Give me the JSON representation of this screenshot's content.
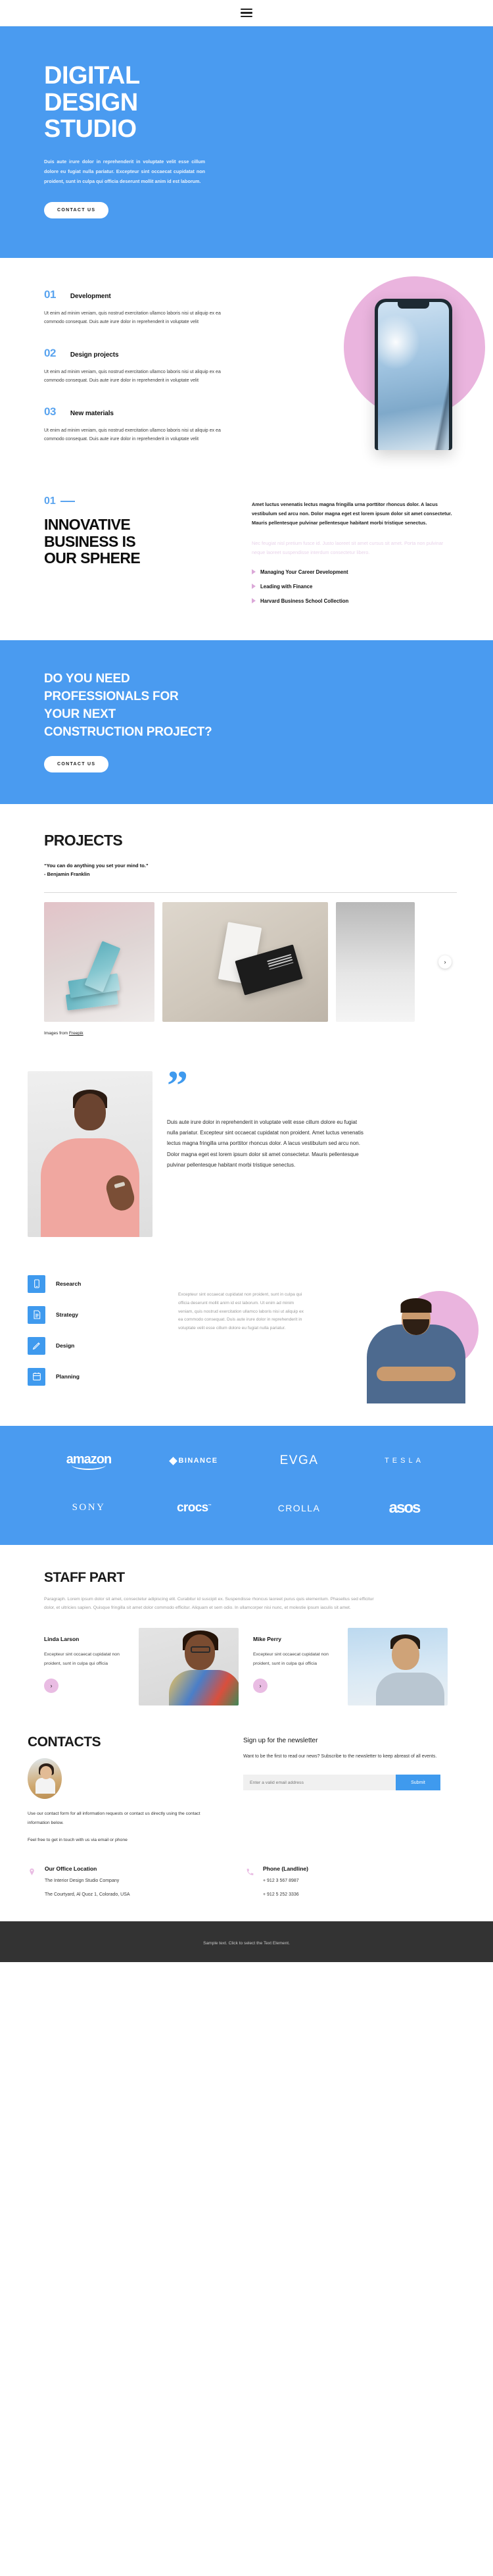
{
  "topbar": {
    "menu_icon": "hamburger-menu-icon"
  },
  "hero": {
    "title_line1": "DIGITAL",
    "title_line2": "DESIGN",
    "title_line3": "STUDIO",
    "paragraph": "Duis aute irure dolor in reprehenderit in voluptate velit esse cillum dolore eu fugiat nulla pariatur. Excepteur sint occaecat cupidatat non proident, sunt in culpa qui officia deserunt mollit anim id est laborum.",
    "cta_label": "CONTACT US",
    "bg_color": "#4a9bf0"
  },
  "features": {
    "body_text": "Ut enim ad minim veniam, quis nostrud exercitation ullamco laboris nisi ut aliquip ex ea commodo consequat. Duis aute irure dolor in reprehenderit in voluptate velit",
    "items": [
      {
        "num": "01",
        "title": "Development"
      },
      {
        "num": "02",
        "title": "Design projects"
      },
      {
        "num": "03",
        "title": "New materials"
      }
    ],
    "circle_color": "#eab4de"
  },
  "innovative": {
    "kicker": "01",
    "heading_line1": "INNOVATIVE",
    "heading_line2": "BUSINESS IS",
    "heading_line3": "OUR SPHERE",
    "paragraph_dark": "Amet luctus venenatis lectus magna fringilla urna porttitor rhoncus dolor. A lacus vestibulum sed arcu non. Dolor magna eget est lorem ipsum dolor sit amet consectetur. Mauris pellentesque pulvinar pellentesque habitant morbi tristique senectus.",
    "paragraph_faded": "Nec feugiat nisl pretium fusce id. Justo laoreet sit amet cursus sit amet. Porta non pulvinar neque laoreet suspendisse interdum consectetur libero.",
    "links": [
      "Managing Your Career Development",
      "Leading with Finance",
      "Harvard Business School Collection"
    ]
  },
  "cta": {
    "heading_line1": "DO YOU NEED",
    "heading_line2": "PROFESSIONALS FOR",
    "heading_line3": "YOUR NEXT",
    "heading_line4": "CONSTRUCTION PROJECT?",
    "button_label": "CONTACT US"
  },
  "projects": {
    "title": "PROJECTS",
    "quote": "“You can do anything you set your mind to.”",
    "author": "- Benjamin Franklin",
    "credit_prefix": "Images from ",
    "credit_link": "Freepik",
    "next_icon": "chevron-right-icon",
    "cards": [
      {
        "name": "book-covers-mockup"
      },
      {
        "name": "business-cards-mockup"
      },
      {
        "name": "next-slide-peek"
      }
    ]
  },
  "testimonial": {
    "quote_mark": "”",
    "text": "Duis aute irure dolor in reprehenderit in voluptate velit esse cillum dolore eu fugiat nulla pariatur. Excepteur sint occaecat cupidatat non proident. Amet luctus venenatis lectus magna fringilla urna porttitor rhoncus dolor. A lacus vestibulum sed arcu non. Dolor magna eget est lorem ipsum dolor sit amet consectetur. Mauris pellentesque pulvinar pellentesque habitant morbi tristique senectus."
  },
  "services": {
    "items": [
      {
        "label": "Research",
        "icon": "mobile-phone-icon"
      },
      {
        "label": "Strategy",
        "icon": "document-list-icon"
      },
      {
        "label": "Design",
        "icon": "pencil-icon"
      },
      {
        "label": "Planning",
        "icon": "calendar-icon"
      }
    ],
    "text": "Excepteur sint occaecat cupidatat non proident, sunt in culpa qui officia deserunt mollit anim id est laborum. Ut enim ad minim veniam, quis nostrud exercitation ullamco laboris nisi ut aliquip ex ea commodo consequat. Duis aute irure dolor in reprehenderit in voluptate velit esse cillum dolore eu fugiat nulla pariatur.",
    "icon_color": "#3f9aee"
  },
  "logos": {
    "items": [
      {
        "name": "amazon"
      },
      {
        "name": "BINANCE"
      },
      {
        "name": "EVGA"
      },
      {
        "name": "TESLA"
      },
      {
        "name": "SONY"
      },
      {
        "name": "crocs"
      },
      {
        "name": "CROLLA"
      },
      {
        "name": "asos"
      }
    ],
    "bg_color": "#4a9bf0"
  },
  "staff": {
    "title": "STAFF PART",
    "paragraph": "Paragraph. Lorem ipsum dolor sit amet, consectetur adipiscing elit. Curabitur id suscipit ex. Suspendisse rhoncus laoreet purus quis elementum. Phasellus sed efficitur dolor, et ultricies sapien. Quisque fringilla sit amet dolor commodo efficitur. Aliquam et sem odio. In ullamcorper nisi nunc, et molestie ipsum iaculis sit amet.",
    "members": [
      {
        "name": "Linda Larson",
        "desc": "Excepteur sint occaecat cupidatat non proident, sunt in culpa qui officia",
        "arrow_icon": "chevron-right-icon"
      },
      {
        "name": "Mike Perry",
        "desc": "Excepteur sint occaecat cupidatat non proident, sunt in culpa qui officia",
        "arrow_icon": "chevron-right-icon"
      }
    ]
  },
  "contacts": {
    "title": "CONTACTS",
    "paragraph1": "Use our contact form for all information requests or contact us directly using the contact information below.",
    "paragraph2": "Feel free to get in touch with us via email or phone",
    "newsletter": {
      "heading": "Sign up for the newsletter",
      "text": "Want to be the first to read our news? Subscribe to the newsletter to keep abreast of all events.",
      "placeholder": "Enter a valid email address",
      "submit_label": "Submit",
      "button_color": "#3f9aee"
    },
    "office": {
      "icon": "map-pin-icon",
      "title": "Our Office Location",
      "line1": "The Interior Design Studio Company",
      "line2": "The Courtyard, Al Quoz 1, Colorado,  USA"
    },
    "phone": {
      "icon": "phone-icon",
      "title": "Phone (Landline)",
      "line1": "+ 912 3 567 8987",
      "line2": "+ 912 5 252 3336"
    },
    "accent_color": "#e9bce3"
  },
  "footer": {
    "text": "Sample text. Click to select the Text Element."
  }
}
